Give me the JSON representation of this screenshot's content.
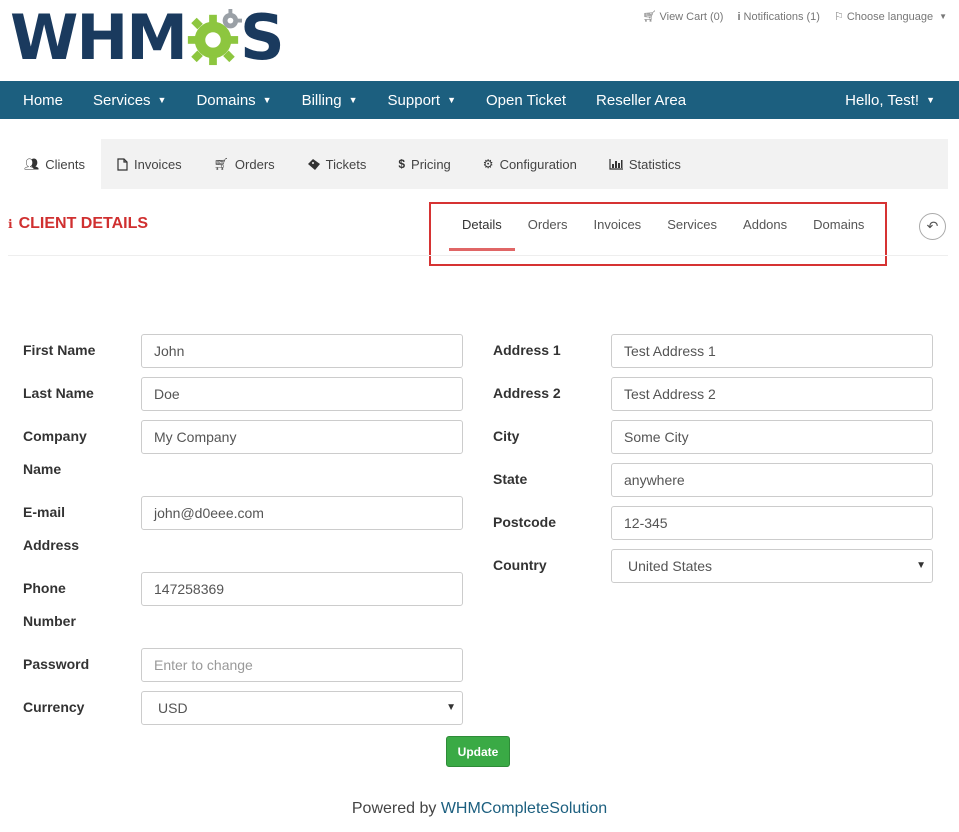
{
  "logo": {
    "text_left": "WHM",
    "text_right": "S",
    "gear_color": "#8dc63f",
    "gear_color_alt": "#9aa0a6"
  },
  "topbar": {
    "view_cart": "View Cart (0)",
    "notifications": "Notifications (1)",
    "choose_language": "Choose language"
  },
  "nav": {
    "items": [
      {
        "label": "Home"
      },
      {
        "label": "Services"
      },
      {
        "label": "Domains"
      },
      {
        "label": "Billing"
      },
      {
        "label": "Support"
      },
      {
        "label": "Open Ticket"
      },
      {
        "label": "Reseller Area"
      }
    ],
    "user": "Hello, Test!"
  },
  "subnav": {
    "items": [
      {
        "label": "Clients",
        "icon": "users-icon"
      },
      {
        "label": "Invoices",
        "icon": "file-icon"
      },
      {
        "label": "Orders",
        "icon": "cart-icon"
      },
      {
        "label": "Tickets",
        "icon": "ticket-icon"
      },
      {
        "label": "Pricing",
        "icon": "dollar-icon"
      },
      {
        "label": "Configuration",
        "icon": "cogs-icon"
      },
      {
        "label": "Statistics",
        "icon": "bar-chart-icon"
      }
    ]
  },
  "client_details": {
    "title": "CLIENT DETAILS",
    "tabs": [
      "Details",
      "Orders",
      "Invoices",
      "Services",
      "Addons",
      "Domains"
    ],
    "active_tab": "Details"
  },
  "form": {
    "left": {
      "first_name": {
        "label": "First Name",
        "value": "John"
      },
      "last_name": {
        "label": "Last Name",
        "value": "Doe"
      },
      "company_name": {
        "label_1": "Company",
        "label_2": "Name",
        "value": "My Company"
      },
      "email": {
        "label_1": "E-mail",
        "label_2": "Address",
        "value": "john@d0eee.com"
      },
      "phone": {
        "label_1": "Phone",
        "label_2": "Number",
        "value": "147258369"
      },
      "password": {
        "label": "Password",
        "placeholder": "Enter to change"
      },
      "currency": {
        "label": "Currency",
        "value": "USD"
      }
    },
    "right": {
      "address1": {
        "label": "Address 1",
        "value": "Test Address 1"
      },
      "address2": {
        "label": "Address 2",
        "value": "Test Address 2"
      },
      "city": {
        "label": "City",
        "value": "Some City"
      },
      "state": {
        "label": "State",
        "value": "anywhere"
      },
      "postcode": {
        "label": "Postcode",
        "value": "12-345"
      },
      "country": {
        "label": "Country",
        "value": "United States"
      }
    },
    "update_label": "Update"
  },
  "footer": {
    "prefix": "Powered by",
    "link": "WHMCompleteSolution"
  },
  "colors": {
    "navbar": "#1c5f7f",
    "accent_red": "#d03030",
    "update_green": "#3aaa45"
  }
}
